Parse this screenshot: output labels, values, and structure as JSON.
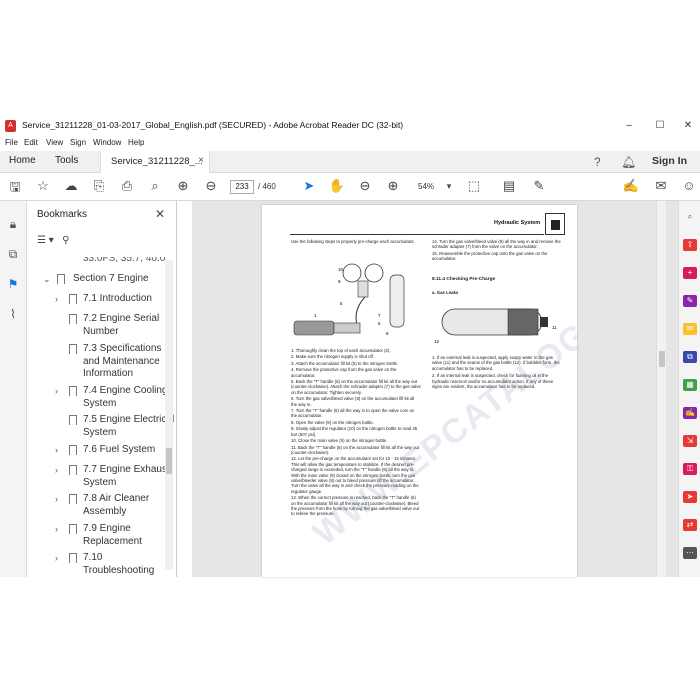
{
  "window": {
    "title": "Service_31211228_01-03-2017_Global_English.pdf (SECURED) - Adobe Acrobat Reader DC (32-bit)",
    "minimize": "–",
    "maximize": "☐",
    "close": "✕"
  },
  "menu": [
    "File",
    "Edit",
    "View",
    "Sign",
    "Window",
    "Help"
  ],
  "tabs": {
    "home": "Home",
    "tools": "Tools",
    "document": "Service_31211228_...",
    "document_close": "×",
    "sign_in": "Sign In"
  },
  "toolbar": {
    "page_current": "233",
    "page_total": "/ 460",
    "zoom": "54%"
  },
  "bookmarks": {
    "header": "Bookmarks",
    "close": "✕",
    "items": [
      {
        "label": "33.0FS, 35.7, 40.0,",
        "level": 2,
        "expandable": false
      },
      {
        "label": "Section 7 Engine",
        "level": 1,
        "expandable": true,
        "expanded": true
      },
      {
        "label": "7.1 Introduction",
        "level": 2,
        "expandable": true
      },
      {
        "label": "7.2 Engine Serial Number",
        "level": 2,
        "expandable": false
      },
      {
        "label": "7.3 Specifications and Maintenance Information",
        "level": 2,
        "expandable": false
      },
      {
        "label": "7.4 Engine Cooling System",
        "level": 2,
        "expandable": true
      },
      {
        "label": "7.5 Engine Electrical System",
        "level": 2,
        "expandable": false
      },
      {
        "label": "7.6 Fuel System",
        "level": 2,
        "expandable": true
      },
      {
        "label": "7.7 Engine Exhaust System",
        "level": 2,
        "expandable": true
      },
      {
        "label": "7.8 Air Cleaner Assembly",
        "level": 2,
        "expandable": true
      },
      {
        "label": "7.9 Engine Replacement",
        "level": 2,
        "expandable": true
      },
      {
        "label": "7.10 Troubleshooting",
        "level": 2,
        "expandable": true
      }
    ]
  },
  "page": {
    "header": "Hydraulic System",
    "intro": "Use the following steps to properly pre-charge each accumulator.",
    "steps_left": [
      "1. Thoroughly clean the top of each accumulator (2).",
      "2. Make sure the nitrogen supply is shut off.",
      "3. Attach the accumulator fill kit (5) to the nitrogen bottle.",
      "4. Remove the protective cap from the gas valve on the accumulator.",
      "5. Back the \"T\" handle (6) on the accumulator fill kit all the way out (counter-clockwise). Attach the schrader adapter (7) to the gas valve on the accumulator. Tighten securely.",
      "6. Turn the gas valve/bleed valve (8) on the accumulator fill kit all the way in.",
      "7. Turn the \"T\" handle (6) all the way in to open the valve core on the accumulator.",
      "8. Open the valve (9) on the nitrogen bottle.",
      "9. Slowly adjust the regulator (10) on the nitrogen bottle to read 35 bar (507 psi).",
      "10. Close the main valve (9) on the nitrogen bottle.",
      "11. Back the \"T\" handle (6) on the accumulator fill kit all the way out (counter-clockwise).",
      "12. Let the pre-charge on the accumulator set for 10 - 15 minutes. This will allow the gas temperature to stabilize. If the desired pre-charged range is exceeded, turn the \"T\" handle (6) all the way in. With the main valve (9) closed on the nitrogen bottle, turn the gas valve/bleeder valve (8) out to bleed pressure off the accumulator. Turn the valve all the way in and check the pressure reading on the regulator gauge.",
      "13. When the correct pressure is reached, back the \"T\" handle (6) on the accumulator fill kit all the way out (counter-clockwise). Bleed the pressure from the hose by turning the gas valve/bleed valve out to relieve the pressure."
    ],
    "steps_right": [
      "14. Turn the gas valve/bleed valve (8) all the way in and remove the schrader adapter (7) from the valve on the accumulator.",
      "15. Reassemble the protective cap onto the gas valve on the accumulator."
    ],
    "section_title": "8.11.4     Checking Pre-Charge",
    "subsection": "a.   Gas Leaks",
    "leaks": [
      "1. If an external leak is suspected, apply soapy water to the gas valve (11) and the seams of the gas bottle (12). If bubbles form, the accumulator has to be replaced.",
      "2. If an internal leak is suspected, check for foaming oil in the hydraulic reservoir and/or no accumulator action. If any of these signs are evident, the accumulator has to be replaced."
    ],
    "fig_left_labels": [
      "10",
      "9",
      "5",
      "1",
      "7",
      "6",
      "8"
    ],
    "fig_right_labels": [
      "11",
      "12"
    ],
    "watermark": "WWW.EPCATALOG.COM"
  },
  "colors": {
    "accent_blue": "#1a73e8",
    "page_bg": "#ffffff",
    "doc_bg": "#e6e6e6"
  }
}
